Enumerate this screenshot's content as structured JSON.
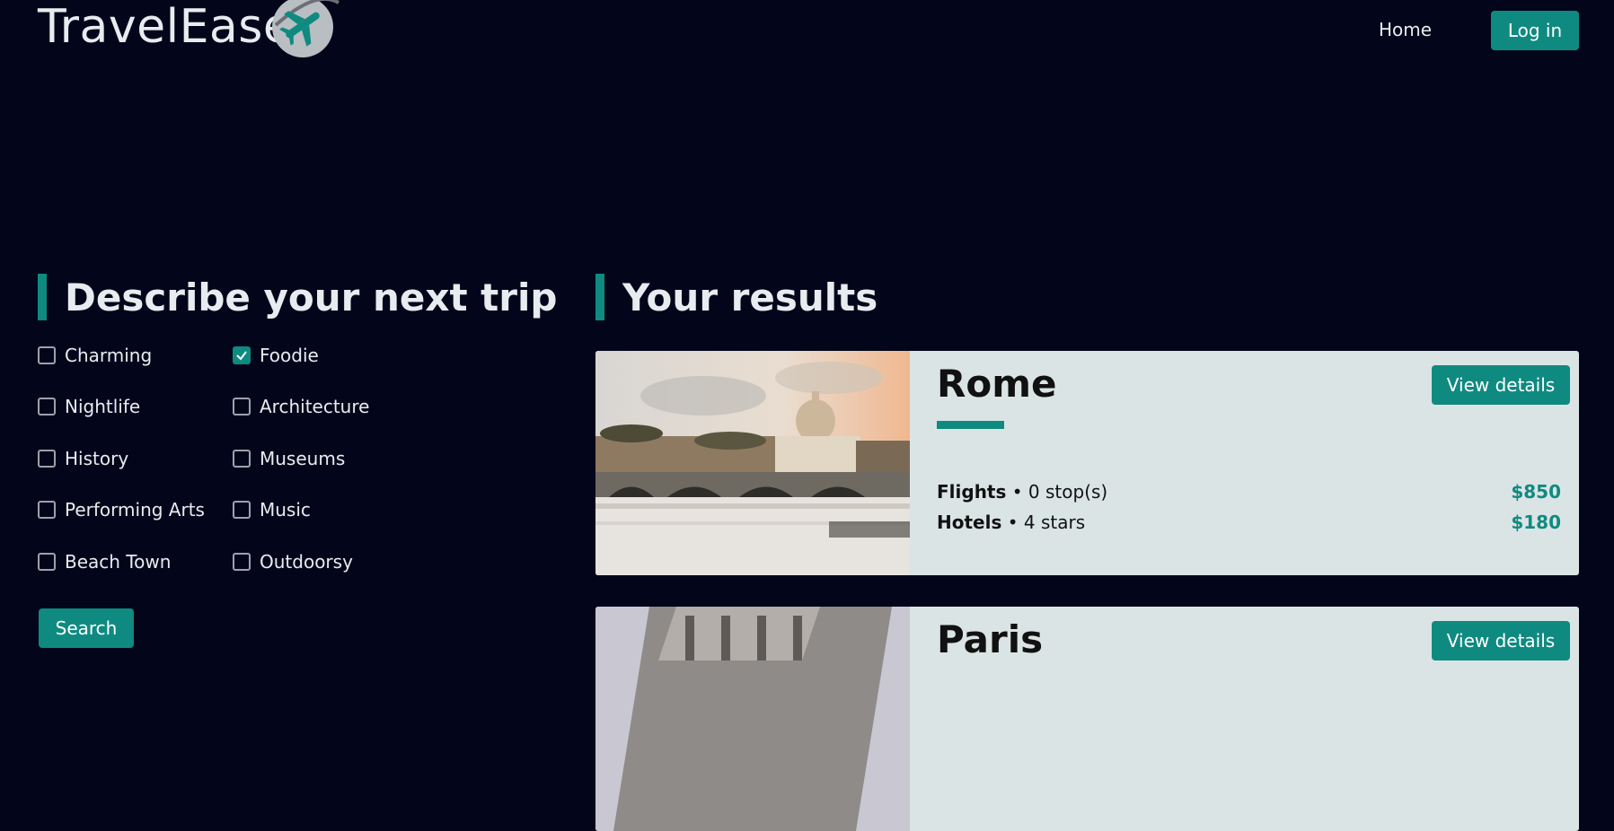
{
  "header": {
    "logo_text": "TravelEase",
    "nav_home": "Home",
    "login_label": "Log in"
  },
  "left": {
    "title": "Describe your next trip",
    "tags": [
      {
        "label": "Charming",
        "checked": false
      },
      {
        "label": "Foodie",
        "checked": true
      },
      {
        "label": "Nightlife",
        "checked": false
      },
      {
        "label": "Architecture",
        "checked": false
      },
      {
        "label": "History",
        "checked": false
      },
      {
        "label": "Museums",
        "checked": false
      },
      {
        "label": "Performing Arts",
        "checked": false
      },
      {
        "label": "Music",
        "checked": false
      },
      {
        "label": "Beach Town",
        "checked": false
      },
      {
        "label": "Outdoorsy",
        "checked": false
      }
    ],
    "search_label": "Search"
  },
  "right": {
    "title": "Your results",
    "results": [
      {
        "city": "Rome",
        "details_label": "View details",
        "flights_label": "Flights",
        "flights_value": "• 0 stop(s)",
        "flights_price": "$850",
        "hotels_label": "Hotels",
        "hotels_value": "• 4 stars",
        "hotels_price": "$180"
      },
      {
        "city": "Paris",
        "details_label": "View details"
      }
    ]
  },
  "colors": {
    "background": "#03061a",
    "accent": "#0f8a80",
    "card": "#dbe4e5"
  }
}
